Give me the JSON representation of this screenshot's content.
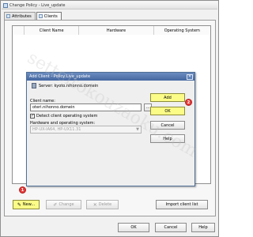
{
  "window": {
    "title": "Change Policy - Live_update",
    "buttons": {
      "ok": "OK",
      "cancel": "Cancel",
      "help": "Help"
    }
  },
  "tabs": [
    {
      "label": "Attributes",
      "active": false
    },
    {
      "label": "Clients",
      "active": true
    }
  ],
  "client_list": {
    "columns": [
      "",
      "Client Name",
      "Hardware",
      "Operating System"
    ],
    "rows": []
  },
  "list_buttons": {
    "new": "New...",
    "change": "Change",
    "delete": "Delete",
    "import": "Import client list"
  },
  "dialog": {
    "title": "Add Client - Policy Live_update",
    "server_label": "Server: kyoto.nihonno.domein",
    "client_name_label": "Client name:",
    "client_name_value": "oteri.nihonno.domein",
    "browse_label": "...",
    "detect_os_label": "Detect client operating system",
    "detect_os_checked": true,
    "hw_os_label": "Hardware and operating system:",
    "hw_os_value": "HP-UX-IA64, HP-UX11.31",
    "buttons": {
      "add": "Add",
      "ok": "OK",
      "cancel": "Cancel",
      "help": "Help"
    }
  },
  "markers": {
    "one": "1",
    "two": "2"
  },
  "watermark": "setteitokouzaoku.com",
  "colors": {
    "highlight": "#fbfb88",
    "marker": "#e53a3a",
    "dialog_titlebar": "#4f72a8"
  }
}
